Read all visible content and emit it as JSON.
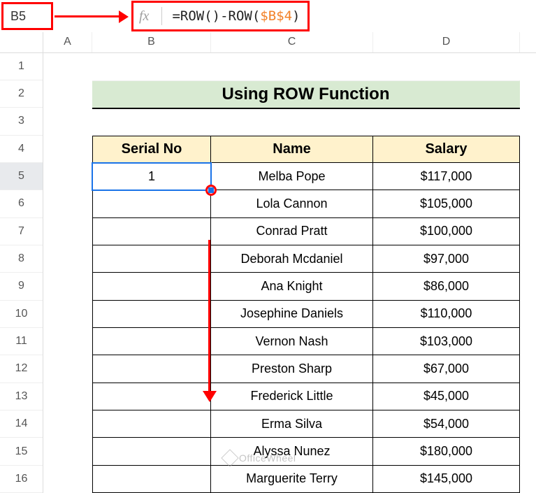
{
  "nameBox": "B5",
  "fxLabel": "fx",
  "formula": {
    "prefix": "=ROW()-ROW(",
    "ref": "$B$4",
    "suffix": ")"
  },
  "columns": [
    "A",
    "B",
    "C",
    "D"
  ],
  "rows": [
    "1",
    "2",
    "3",
    "4",
    "5",
    "6",
    "7",
    "8",
    "9",
    "10",
    "11",
    "12",
    "13",
    "14",
    "15",
    "16"
  ],
  "title": "Using ROW Function",
  "headers": {
    "serial": "Serial No",
    "name": "Name",
    "salary": "Salary"
  },
  "selectedSerial": "1",
  "table": [
    {
      "name": "Melba Pope",
      "salary": "$117,000"
    },
    {
      "name": "Lola Cannon",
      "salary": "$105,000"
    },
    {
      "name": "Conrad Pratt",
      "salary": "$100,000"
    },
    {
      "name": "Deborah Mcdaniel",
      "salary": "$97,000"
    },
    {
      "name": "Ana Knight",
      "salary": "$86,000"
    },
    {
      "name": "Josephine Daniels",
      "salary": "$110,000"
    },
    {
      "name": "Vernon Nash",
      "salary": "$103,000"
    },
    {
      "name": "Preston Sharp",
      "salary": "$67,000"
    },
    {
      "name": "Frederick Little",
      "salary": "$45,000"
    },
    {
      "name": "Erma Silva",
      "salary": "$54,000"
    },
    {
      "name": "Alyssa Nunez",
      "salary": "$180,000"
    },
    {
      "name": "Marguerite Terry",
      "salary": "$145,000"
    }
  ],
  "watermark": "OfficeWheel"
}
